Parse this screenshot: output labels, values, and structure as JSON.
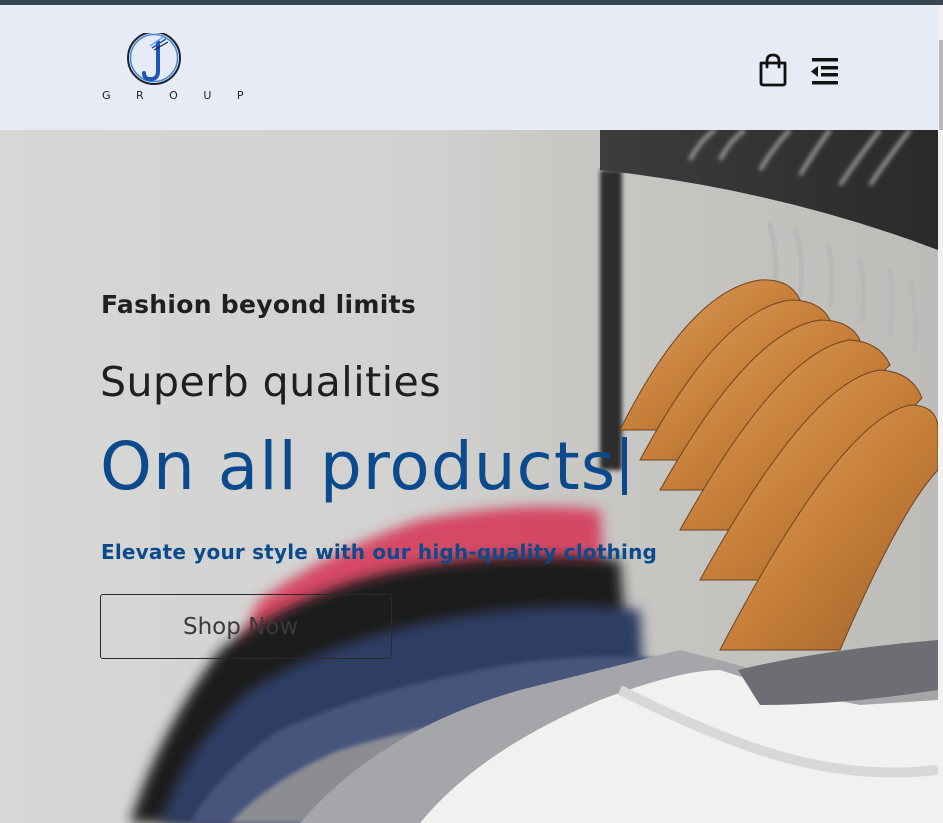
{
  "header": {
    "logo_text": "G R O U P",
    "logo_alt": "J Group logo",
    "bag_icon": "shopping-bag-icon",
    "menu_icon": "menu-collapse-icon"
  },
  "hero": {
    "tagline": "Fashion beyond limits",
    "headline_line1": "Superb qualities",
    "headline_line2": "On all products",
    "subline": "Elevate your style with our high-quality clothing",
    "cta_label": "Shop Now",
    "accent_color": "#0b4a8c",
    "background": "photo of shirts on wooden hangers"
  }
}
